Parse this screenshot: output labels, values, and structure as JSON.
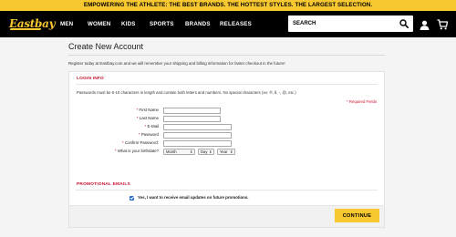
{
  "promo_bar": {
    "text": "EMPOWERING THE ATHLETE: THE BEST BRANDS. THE HOTTEST STYLES. THE LARGEST SELECTION."
  },
  "header": {
    "logo_text": "Eastbay",
    "nav": [
      "MEN",
      "WOMEN",
      "KIDS",
      "SPORTS",
      "BRANDS",
      "RELEASES"
    ],
    "search": {
      "placeholder": "SEARCH",
      "icon": "search-icon"
    },
    "icons": [
      "user-icon",
      "cart-icon"
    ]
  },
  "page": {
    "title": "Create New Account",
    "intro": "Register today at Eastbay.com and we will remember your shipping and billing information for faster checkout in the future!"
  },
  "login_info": {
    "title": "LOGIN INFO",
    "password_note": "Passwords must be 6-10 characters in length and contain both letters and numbers. No special characters (ex: ®, å, -, @, etc.)",
    "required_note": "* Required Fields",
    "fields": [
      {
        "star": "*",
        "label": "First Name",
        "value": ""
      },
      {
        "star": "*",
        "label": "Last Name",
        "value": ""
      },
      {
        "star": "*",
        "label": "E-Mail",
        "value": ""
      },
      {
        "star": "*",
        "label": "Password",
        "value": ""
      },
      {
        "star": "*",
        "label": "Confirm Password:",
        "value": ""
      },
      {
        "star": "*",
        "label": "What is your birthdate?",
        "value": ""
      }
    ],
    "birthdate": {
      "month": "Month",
      "day": "Day",
      "year": "Year"
    }
  },
  "promotional": {
    "title": "PROMOTIONAL EMAILS",
    "checkbox_checked": true,
    "checkbox_label": "Yes, I want to receive email updates on future promotions."
  },
  "actions": {
    "continue_label": "CONTINUE"
  },
  "colors": {
    "accent": "#f7c830",
    "required": "#c8102e",
    "nav_bg": "#000000",
    "checkbox": "#2a6fd6"
  }
}
